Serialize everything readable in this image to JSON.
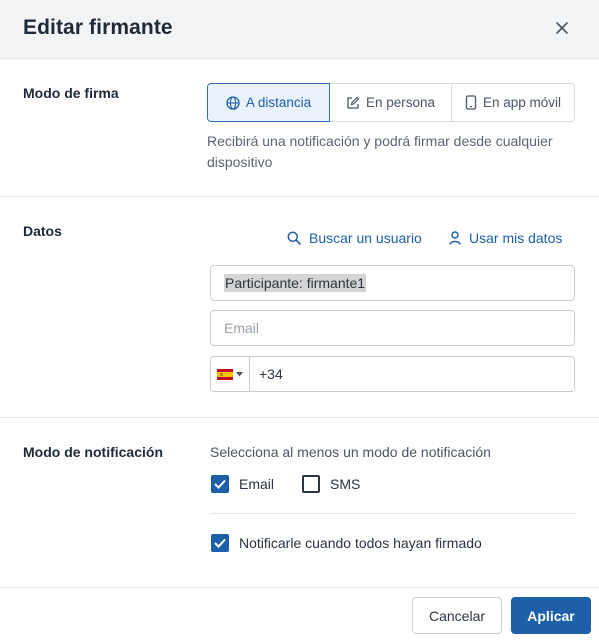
{
  "dialog": {
    "title": "Editar firmante",
    "close_icon": "close-icon"
  },
  "signature_mode": {
    "label": "Modo de firma",
    "options": [
      {
        "label": "A distancia",
        "icon": "globe-icon",
        "selected": true
      },
      {
        "label": "En persona",
        "icon": "pencil-square-icon",
        "selected": false
      },
      {
        "label": "En app móvil",
        "icon": "mobile-phone-icon",
        "selected": false
      }
    ],
    "help_text": "Recibirá una notificación y podrá firmar desde cualquier dispositivo"
  },
  "data_section": {
    "label": "Datos",
    "search_user_link": "Buscar un usuario",
    "use_my_data_link": "Usar mis datos",
    "participant_value": "Participante: firmante1",
    "email_placeholder": "Email",
    "email_value": "",
    "phone_value": "+34",
    "phone_country": "ES"
  },
  "notification": {
    "label": "Modo de notificación",
    "help_text": "Selecciona al menos un modo de notificación",
    "email_label": "Email",
    "email_checked": true,
    "sms_label": "SMS",
    "sms_checked": false,
    "notify_all_label": "Notificarle cuando todos hayan firmado",
    "notify_all_checked": true
  },
  "footer": {
    "cancel_label": "Cancelar",
    "apply_label": "Aplicar"
  },
  "colors": {
    "primary": "#1d5fa8",
    "header_bg": "#f3f4f6",
    "active_mode_bg": "#eaf2fc"
  }
}
